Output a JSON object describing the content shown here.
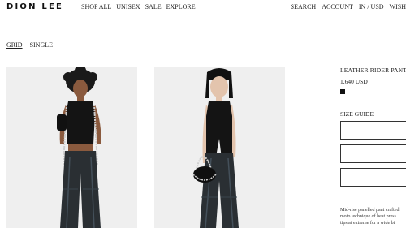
{
  "header": {
    "logo": "DION LEE",
    "nav_left": [
      "SHOP ALL",
      "UNISEX",
      "SALE",
      "EXPLORE"
    ],
    "nav_right": [
      "SEARCH",
      "ACCOUNT",
      "IN / USD",
      "WISH"
    ]
  },
  "view_toggle": {
    "grid_label": "GRID",
    "single_label": "SINGLE",
    "active": "GRID"
  },
  "product": {
    "name": "LEATHER RIDER PANT",
    "price": "1,640 USD",
    "swatch_color": "#111111",
    "size_guide_label": "SIZE GUIDE",
    "description_lines": [
      "Mid-rise panelled pant crafted",
      "moto technique of heat press",
      "tips at extreme for a wide bi"
    ]
  },
  "images": [
    {
      "alt": "model wearing black sleeveless top and leather rider pants with chain harness"
    },
    {
      "alt": "model wearing black sleeveless split top and leather rider pants holding chain bag"
    }
  ]
}
